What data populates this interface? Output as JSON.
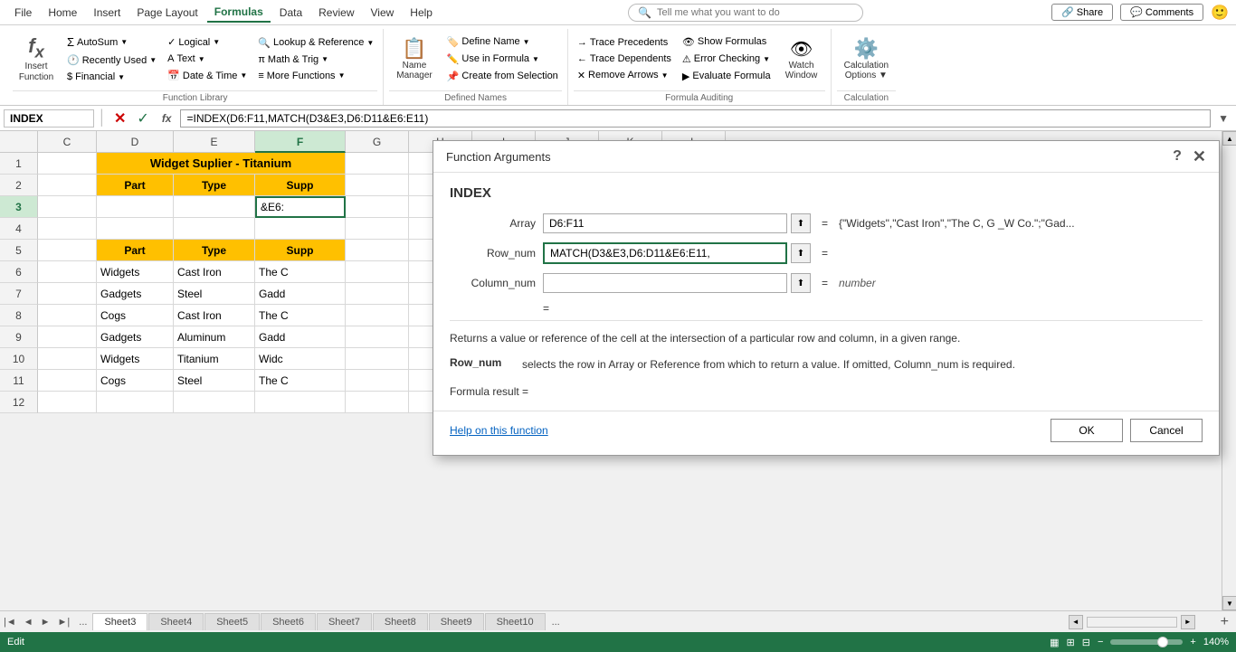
{
  "app": {
    "title": "Excel - Function Arguments"
  },
  "menu": {
    "items": [
      "File",
      "Home",
      "Insert",
      "Page Layout",
      "Formulas",
      "Data",
      "Review",
      "View",
      "Help"
    ],
    "active": "Formulas",
    "search_placeholder": "Tell me what you want to do"
  },
  "ribbon": {
    "groups": [
      {
        "name": "function_library",
        "label": "Function Library",
        "buttons": [
          {
            "id": "insert_function",
            "label": "Insert\nFunction",
            "icon": "fx"
          },
          {
            "id": "autosum",
            "label": "AutoSum",
            "icon": "Σ",
            "dropdown": true
          },
          {
            "id": "recently_used",
            "label": "Recently Used",
            "dropdown": true
          },
          {
            "id": "financial",
            "label": "Financial",
            "dropdown": true
          },
          {
            "id": "logical",
            "label": "Logical",
            "dropdown": true
          },
          {
            "id": "text",
            "label": "Text",
            "dropdown": true
          },
          {
            "id": "date_time",
            "label": "Date & Time",
            "dropdown": true
          },
          {
            "id": "lookup_reference",
            "label": "Lookup &\nReference",
            "dropdown": true
          },
          {
            "id": "math_trig",
            "label": "Math &\nTrig",
            "dropdown": true
          },
          {
            "id": "more_functions",
            "label": "More\nFunctions",
            "dropdown": true
          }
        ]
      },
      {
        "name": "defined_names",
        "label": "Defined Names",
        "buttons": [
          {
            "id": "name_manager",
            "label": "Name\nManager",
            "icon": "📋"
          },
          {
            "id": "define_name",
            "label": "Define Name",
            "dropdown": true
          },
          {
            "id": "use_in_formula",
            "label": "Use in Formula",
            "dropdown": true
          },
          {
            "id": "create_from_selection",
            "label": "Create from\nSelection"
          }
        ]
      },
      {
        "name": "formula_auditing",
        "label": "Formula Auditing",
        "buttons": [
          {
            "id": "trace_precedents",
            "label": "Trace Precedents"
          },
          {
            "id": "trace_dependents",
            "label": "Trace Dependents"
          },
          {
            "id": "remove_arrows",
            "label": "Remove Arrows",
            "dropdown": true
          },
          {
            "id": "show_formulas",
            "label": "Show Formulas"
          },
          {
            "id": "error_checking",
            "label": "Error Checking",
            "dropdown": true
          },
          {
            "id": "evaluate_formula",
            "label": "Evaluate Formula"
          },
          {
            "id": "watch_window",
            "label": "Watch\nWindow",
            "icon": "👁"
          }
        ]
      },
      {
        "name": "calculation",
        "label": "Calculation",
        "buttons": [
          {
            "id": "calculation_options",
            "label": "Calculation\nOptions",
            "dropdown": true
          }
        ]
      }
    ]
  },
  "formula_bar": {
    "cell_ref": "INDEX",
    "formula": "=INDEX(D6:F11,MATCH(D3&E3,D6:D11&E6:E11)"
  },
  "spreadsheet": {
    "col_headers": [
      "C",
      "D",
      "E",
      "F",
      "G",
      "H",
      "I",
      "J",
      "K",
      "L"
    ],
    "active_col": "F",
    "active_row": 3,
    "rows": [
      {
        "row": 1,
        "cells": [
          {
            "col": "C",
            "value": ""
          },
          {
            "col": "D",
            "value": "Widget Suplier - Titanium",
            "span": 3,
            "style": "bold center yellow"
          },
          {
            "col": "G",
            "value": ""
          },
          {
            "col": "H",
            "value": ""
          },
          {
            "col": "I",
            "value": ""
          },
          {
            "col": "J",
            "value": ""
          },
          {
            "col": "K",
            "value": ""
          },
          {
            "col": "L",
            "value": ""
          }
        ]
      },
      {
        "row": 2,
        "cells": [
          {
            "col": "C",
            "value": ""
          },
          {
            "col": "D",
            "value": "Part",
            "style": "bold center yellow"
          },
          {
            "col": "E",
            "value": "Type",
            "style": "bold center yellow"
          },
          {
            "col": "F",
            "value": "Supp",
            "style": "bold center yellow"
          },
          {
            "col": "G",
            "value": ""
          },
          {
            "col": "H",
            "value": ""
          },
          {
            "col": "I",
            "value": ""
          },
          {
            "col": "J",
            "value": ""
          },
          {
            "col": "K",
            "value": ""
          },
          {
            "col": "L",
            "value": ""
          }
        ]
      },
      {
        "row": 3,
        "cells": [
          {
            "col": "C",
            "value": ""
          },
          {
            "col": "D",
            "value": ""
          },
          {
            "col": "E",
            "value": ""
          },
          {
            "col": "F",
            "value": "&E6:",
            "style": "active"
          },
          {
            "col": "G",
            "value": ""
          },
          {
            "col": "H",
            "value": ""
          },
          {
            "col": "I",
            "value": ""
          },
          {
            "col": "J",
            "value": ""
          },
          {
            "col": "K",
            "value": ""
          },
          {
            "col": "L",
            "value": ""
          }
        ]
      },
      {
        "row": 4,
        "cells": [
          {
            "col": "C",
            "value": ""
          },
          {
            "col": "D",
            "value": ""
          },
          {
            "col": "E",
            "value": ""
          },
          {
            "col": "F",
            "value": ""
          },
          {
            "col": "G",
            "value": ""
          },
          {
            "col": "H",
            "value": ""
          },
          {
            "col": "I",
            "value": ""
          },
          {
            "col": "J",
            "value": ""
          },
          {
            "col": "K",
            "value": ""
          },
          {
            "col": "L",
            "value": ""
          }
        ]
      },
      {
        "row": 5,
        "cells": [
          {
            "col": "C",
            "value": ""
          },
          {
            "col": "D",
            "value": "Part",
            "style": "bold center yellow"
          },
          {
            "col": "E",
            "value": "Type",
            "style": "bold center yellow"
          },
          {
            "col": "F",
            "value": "Supp",
            "style": "bold center yellow"
          },
          {
            "col": "G",
            "value": ""
          },
          {
            "col": "H",
            "value": ""
          },
          {
            "col": "I",
            "value": ""
          },
          {
            "col": "J",
            "value": ""
          },
          {
            "col": "K",
            "value": ""
          },
          {
            "col": "L",
            "value": ""
          }
        ]
      },
      {
        "row": 6,
        "cells": [
          {
            "col": "C",
            "value": ""
          },
          {
            "col": "D",
            "value": "Widgets"
          },
          {
            "col": "E",
            "value": "Cast Iron"
          },
          {
            "col": "F",
            "value": "The C"
          },
          {
            "col": "G",
            "value": ""
          },
          {
            "col": "H",
            "value": ""
          },
          {
            "col": "I",
            "value": ""
          },
          {
            "col": "J",
            "value": ""
          },
          {
            "col": "K",
            "value": ""
          },
          {
            "col": "L",
            "value": ""
          }
        ]
      },
      {
        "row": 7,
        "cells": [
          {
            "col": "C",
            "value": ""
          },
          {
            "col": "D",
            "value": "Gadgets"
          },
          {
            "col": "E",
            "value": "Steel"
          },
          {
            "col": "F",
            "value": "Gadd"
          },
          {
            "col": "G",
            "value": ""
          },
          {
            "col": "H",
            "value": ""
          },
          {
            "col": "I",
            "value": ""
          },
          {
            "col": "J",
            "value": ""
          },
          {
            "col": "K",
            "value": ""
          },
          {
            "col": "L",
            "value": ""
          }
        ]
      },
      {
        "row": 8,
        "cells": [
          {
            "col": "C",
            "value": ""
          },
          {
            "col": "D",
            "value": "Cogs"
          },
          {
            "col": "E",
            "value": "Cast Iron"
          },
          {
            "col": "F",
            "value": "The C"
          },
          {
            "col": "G",
            "value": ""
          },
          {
            "col": "H",
            "value": ""
          },
          {
            "col": "I",
            "value": ""
          },
          {
            "col": "J",
            "value": ""
          },
          {
            "col": "K",
            "value": ""
          },
          {
            "col": "L",
            "value": ""
          }
        ]
      },
      {
        "row": 9,
        "cells": [
          {
            "col": "C",
            "value": ""
          },
          {
            "col": "D",
            "value": "Gadgets"
          },
          {
            "col": "E",
            "value": "Aluminum"
          },
          {
            "col": "F",
            "value": "Gadd"
          },
          {
            "col": "G",
            "value": ""
          },
          {
            "col": "H",
            "value": ""
          },
          {
            "col": "I",
            "value": ""
          },
          {
            "col": "J",
            "value": ""
          },
          {
            "col": "K",
            "value": ""
          },
          {
            "col": "L",
            "value": ""
          }
        ]
      },
      {
        "row": 10,
        "cells": [
          {
            "col": "C",
            "value": ""
          },
          {
            "col": "D",
            "value": "Widgets"
          },
          {
            "col": "E",
            "value": "Titanium"
          },
          {
            "col": "F",
            "value": "Widc"
          },
          {
            "col": "G",
            "value": ""
          },
          {
            "col": "H",
            "value": ""
          },
          {
            "col": "I",
            "value": ""
          },
          {
            "col": "J",
            "value": ""
          },
          {
            "col": "K",
            "value": ""
          },
          {
            "col": "L",
            "value": ""
          }
        ]
      },
      {
        "row": 11,
        "cells": [
          {
            "col": "C",
            "value": ""
          },
          {
            "col": "D",
            "value": "Cogs"
          },
          {
            "col": "E",
            "value": "Steel"
          },
          {
            "col": "F",
            "value": "The C"
          },
          {
            "col": "G",
            "value": ""
          },
          {
            "col": "H",
            "value": ""
          },
          {
            "col": "I",
            "value": ""
          },
          {
            "col": "J",
            "value": ""
          },
          {
            "col": "K",
            "value": ""
          },
          {
            "col": "L",
            "value": ""
          }
        ]
      },
      {
        "row": 12,
        "cells": [
          {
            "col": "C",
            "value": ""
          },
          {
            "col": "D",
            "value": ""
          },
          {
            "col": "E",
            "value": ""
          },
          {
            "col": "F",
            "value": ""
          },
          {
            "col": "G",
            "value": ""
          },
          {
            "col": "H",
            "value": ""
          },
          {
            "col": "I",
            "value": ""
          },
          {
            "col": "J",
            "value": ""
          },
          {
            "col": "K",
            "value": ""
          },
          {
            "col": "L",
            "value": ""
          }
        ]
      }
    ]
  },
  "dialog": {
    "title": "Function Arguments",
    "function_name": "INDEX",
    "fields": [
      {
        "label": "Array",
        "value": "D6:F11",
        "result": "= {\"Widgets\",\"Cast Iron\",\"The C, G _W Co.\";\"Gad..."
      },
      {
        "label": "Row_num",
        "value": "MATCH(D3&E3,D6:D11&E6:E11,",
        "result": "="
      },
      {
        "label": "Column_num",
        "value": "",
        "result": "= number"
      }
    ],
    "description": "Returns a value or reference of the cell at the intersection of a particular row and column, in a given range.",
    "arg_description": {
      "name": "Row_num",
      "text": "selects the row in Array or Reference from which to return a value. If omitted, Column_num is\nrequired."
    },
    "formula_result": "Formula result =",
    "help_link": "Help on this function",
    "ok_label": "OK",
    "cancel_label": "Cancel"
  },
  "sheet_tabs": {
    "tabs": [
      "Sheet3",
      "Sheet4",
      "Sheet5",
      "Sheet6",
      "Sheet7",
      "Sheet8",
      "Sheet9",
      "Sheet10"
    ],
    "active": "Sheet3"
  },
  "status_bar": {
    "mode": "Edit",
    "zoom": "140%"
  }
}
